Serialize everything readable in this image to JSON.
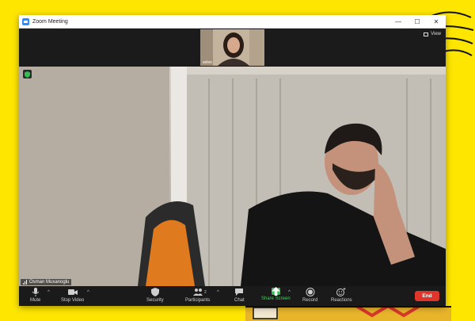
{
  "window": {
    "title": "Zoom Meeting",
    "controls": {
      "minimize": "—",
      "maximize": "☐",
      "close": "✕"
    }
  },
  "thumbnail": {
    "participant_name": "selen"
  },
  "view_button": {
    "label": "View"
  },
  "main_video": {
    "speaker_name": "Osman Muxanoglu"
  },
  "toolbar": {
    "mute": "Mute",
    "stop_video": "Stop Video",
    "security": "Security",
    "participants": "Participants",
    "participants_count": "2",
    "chat": "Chat",
    "share_screen": "Share Screen",
    "record": "Record",
    "reactions": "Reactions",
    "end": "End",
    "caret": "^"
  },
  "colors": {
    "background": "#ffe600",
    "share_green": "#3fd35b",
    "end_red": "#e0352b",
    "zoom_blue": "#2d8cff"
  }
}
